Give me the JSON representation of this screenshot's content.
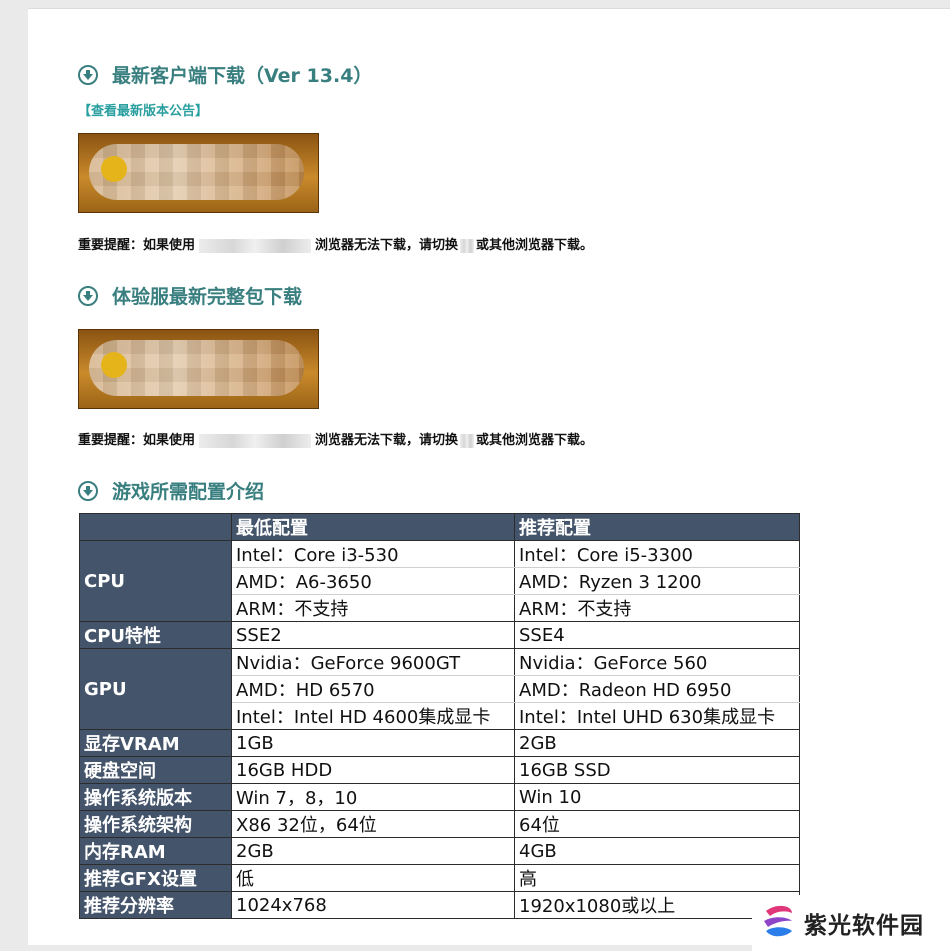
{
  "sections": {
    "client": {
      "title": "最新客户端下载（Ver 13.4）",
      "notice_link": "【查看最新版本公告】"
    },
    "trial": {
      "title": "体验服最新完整包下载"
    },
    "specs": {
      "title": "游戏所需配置介绍"
    }
  },
  "warning": {
    "prefix": "重要提醒：如果使用",
    "middle": "浏览器无法下载，请切换",
    "suffix": "或其他浏览器下载。"
  },
  "table": {
    "headers": [
      "",
      "最低配置",
      "推荐配置"
    ],
    "rows": {
      "cpu": {
        "label": "CPU",
        "min": [
          "Intel：Core i3-530",
          "AMD：A6-3650",
          "ARM：不支持"
        ],
        "rec": [
          "Intel：Core i5-3300",
          "AMD：Ryzen 3 1200",
          "ARM：不支持"
        ]
      },
      "cpu_feature": {
        "label": "CPU特性",
        "min": "SSE2",
        "rec": "SSE4"
      },
      "gpu": {
        "label": "GPU",
        "min": [
          "Nvidia：GeForce 9600GT",
          "AMD：HD 6570",
          "Intel：Intel HD 4600集成显卡"
        ],
        "rec": [
          "Nvidia：GeForce 560",
          "AMD：Radeon HD 6950",
          "Intel：Intel UHD 630集成显卡"
        ]
      },
      "vram": {
        "label": "显存VRAM",
        "min": "1GB",
        "rec": "2GB"
      },
      "disk": {
        "label": "硬盘空间",
        "min": "16GB HDD",
        "rec": "16GB SSD"
      },
      "os_version": {
        "label": "操作系统版本",
        "min": "Win 7，8，10",
        "rec": "Win 10"
      },
      "os_arch": {
        "label": "操作系统架构",
        "min": "X86 32位，64位",
        "rec": "64位"
      },
      "ram": {
        "label": "内存RAM",
        "min": "2GB",
        "rec": "4GB"
      },
      "gfx": {
        "label": "推荐GFX设置",
        "min": "低",
        "rec": "高"
      },
      "resolution": {
        "label": "推荐分辨率",
        "min": "1024x768",
        "rec": "1920x1080或以上"
      }
    }
  },
  "watermark": {
    "text": "紫光软件园"
  },
  "colors": {
    "accent": "#3a7f80",
    "link": "#2a9fa0",
    "table_header": "#44546a"
  }
}
